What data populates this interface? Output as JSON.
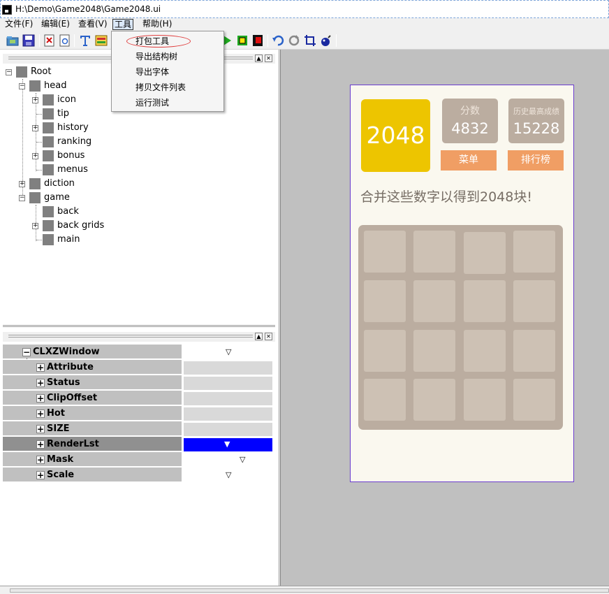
{
  "window": {
    "title": "H:\\Demo\\Game2048\\Game2048.ui"
  },
  "menubar": {
    "items": [
      {
        "label": "文件(F)"
      },
      {
        "label": "编辑(E)"
      },
      {
        "label": "查看(V)"
      },
      {
        "label": "工具"
      },
      {
        "label": "帮助(H)"
      }
    ]
  },
  "tools_menu": {
    "items": [
      {
        "label": "打包工具"
      },
      {
        "label": "导出结构树"
      },
      {
        "label": "导出字体"
      },
      {
        "label": "拷贝文件列表"
      },
      {
        "label": "运行测试"
      }
    ]
  },
  "tree": {
    "root": "Root",
    "head": "head",
    "head_children": [
      "icon",
      "tip",
      "history",
      "ranking",
      "bonus",
      "menus"
    ],
    "diction": "diction",
    "game": "game",
    "game_children": [
      "back",
      "back grids",
      "main"
    ]
  },
  "properties": {
    "root": "CLXZWindow",
    "rows": [
      {
        "name": "Attribute"
      },
      {
        "name": "Status"
      },
      {
        "name": "ClipOffset"
      },
      {
        "name": "Hot"
      },
      {
        "name": "SIZE"
      },
      {
        "name": "RenderLst"
      },
      {
        "name": "Mask"
      },
      {
        "name": "Scale"
      }
    ]
  },
  "game": {
    "logo": "2048",
    "score_label": "分数",
    "score_value": "4832",
    "best_label": "历史最高成绩",
    "best_value": "15228",
    "menu_button": "菜单",
    "ranking_button": "排行榜",
    "tagline": "合并这些数字以得到2048块!"
  },
  "colors": {
    "accent_blue": "#0000ff",
    "logo_gold": "#edc500",
    "board": "#bbada0",
    "cell": "#cdc1b4",
    "orange_button": "#f09e64",
    "canvas_bg": "#faf8ef"
  }
}
